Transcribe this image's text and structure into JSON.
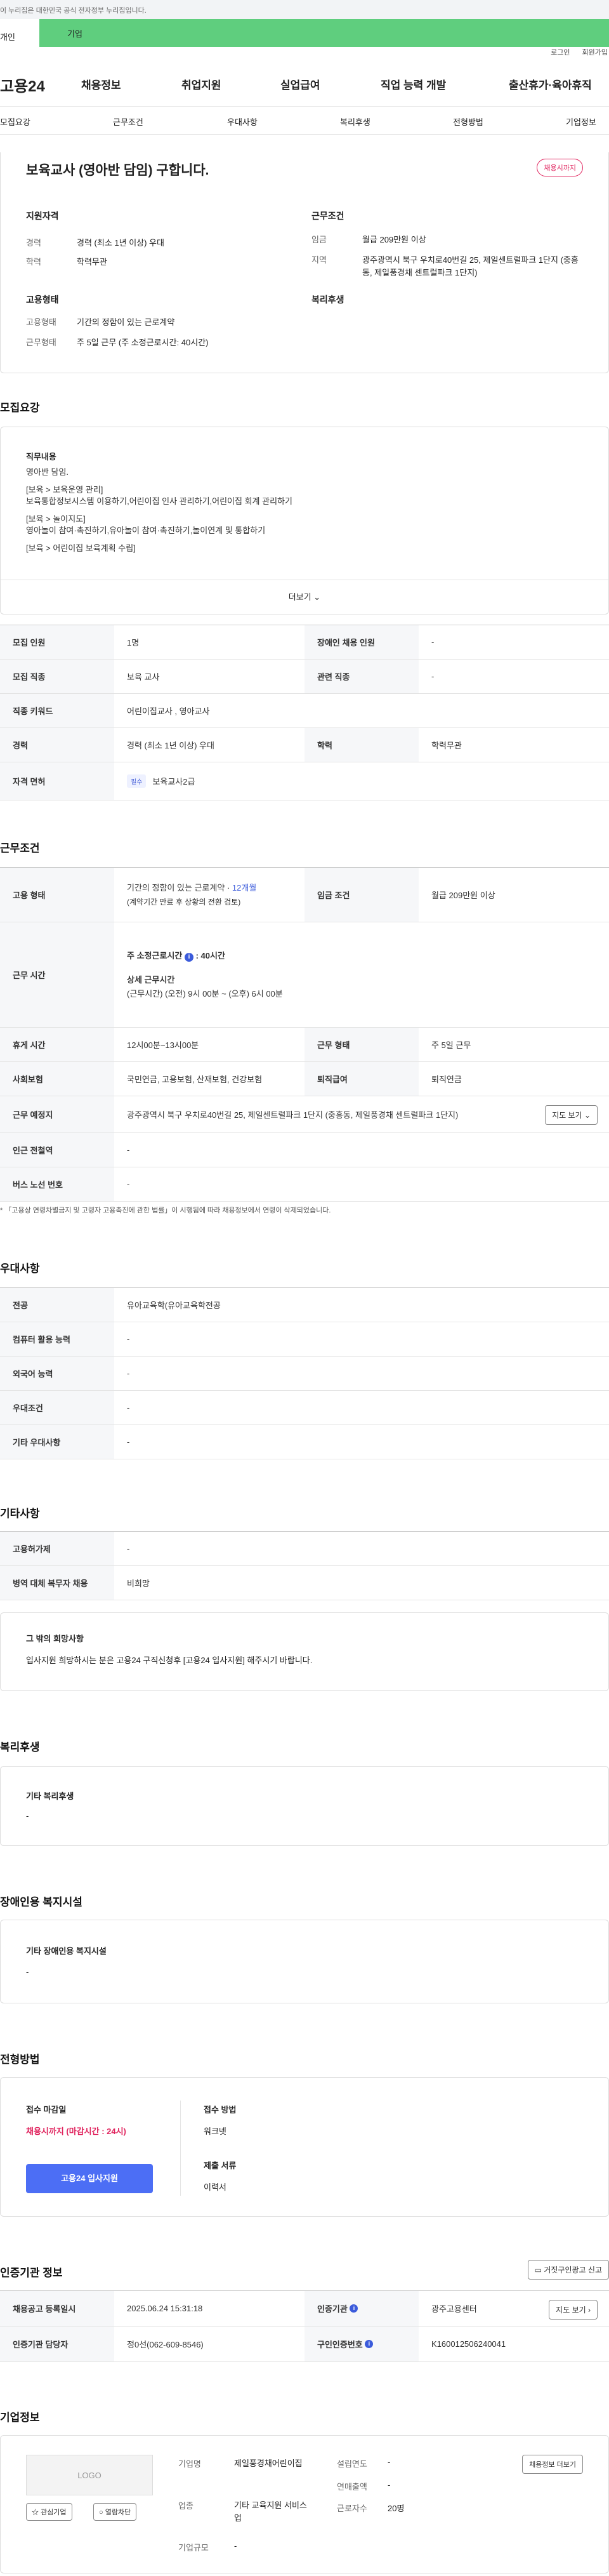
{
  "gov_notice": "이 누리집은 대한민국 공식 전자정부 누리집입니다.",
  "member_tabs": {
    "personal": "개인",
    "business": "기업"
  },
  "util": {
    "login": "로그인",
    "join": "회원가입"
  },
  "logo": "고용24",
  "gnb": [
    "채용정보",
    "취업지원",
    "실업급여",
    "직업 능력 개발",
    "출산휴가·육아휴직"
  ],
  "subnav": [
    "모집요강",
    "근무조건",
    "우대사항",
    "복리후생",
    "전형방법",
    "기업정보"
  ],
  "summary": {
    "title": "보육교사 (영아반 담임) 구합니다.",
    "badge": "채용시까지",
    "qual_title": "지원자격",
    "qual": [
      {
        "k": "경력",
        "v": "경력 (최소 1년 이상) 우대"
      },
      {
        "k": "학력",
        "v": "학력무관"
      }
    ],
    "cond_title": "근무조건",
    "cond": [
      {
        "k": "임금",
        "v": "월급 209만원 이상"
      },
      {
        "k": "지역",
        "v": "광주광역시 북구 우치로40번길 25, 제일센트럴파크 1단지 (중흥동, 제일풍경채 센트럴파크 1단지)"
      }
    ],
    "emp_title": "고용형태",
    "emp": [
      {
        "k": "고용형태",
        "v": "기간의 정함이 있는 근로계약"
      },
      {
        "k": "근무형태",
        "v": "주 5일 근무 (주 소정근로시간: 40시간)"
      }
    ],
    "welfare_title": "복리후생"
  },
  "recruit": {
    "heading": "모집요강",
    "duty_title": "직무내용",
    "duty_lines": [
      "영아반 담임.",
      "",
      "[보육 > 보육운영 관리]",
      "보육통합정보시스템 이용하기,어린이집 인사 관리하기,어린이집 회계 관리하기",
      "",
      "[보육 > 놀이지도]",
      "영아놀이 참여·촉진하기,유아놀이 참여·촉진하기,놀이연계 및 통합하기",
      "",
      "[보육 > 어린이집 보육계획 수립]"
    ],
    "more": "더보기",
    "rows": [
      {
        "k": "모집 인원",
        "v": "1명",
        "k2": "장애인 채용 인원",
        "v2": "-"
      },
      {
        "k": "모집 직종",
        "v": "보육 교사",
        "k2": "관련 직종",
        "v2": "-"
      },
      {
        "k": "직종 키워드",
        "v": "어린이집교사 , 영아교사"
      },
      {
        "k": "경력",
        "v": "경력 (최소 1년 이상) 우대",
        "k2": "학력",
        "v2": "학력무관"
      },
      {
        "k": "자격 면허",
        "badge": "필수",
        "v": "보육교사2급"
      }
    ]
  },
  "work": {
    "heading": "근무조건",
    "emp_k": "고용 형태",
    "emp_v1": "기간의 정함이 있는 근로계약 · ",
    "emp_period": "12개월",
    "emp_v2": "(계약기간 만료 후 상황의 전환 검토)",
    "wage_k": "임금 조건",
    "wage_v": "월급 209만원 이상",
    "hours_k": "근무 시간",
    "hours_week_label": "주 소정근로시간",
    "hours_week_value": ": 40시간",
    "hours_detail_label": "상세 근무시간",
    "hours_detail_value": "(근무시간) (오전) 9시 00분 ~ (오후) 6시 00분",
    "rows": [
      {
        "k": "휴게 시간",
        "v": "12시00분~13시00분",
        "k2": "근무 형태",
        "v2": "주 5일 근무"
      },
      {
        "k": "사회보험",
        "v": "국민연금, 고용보험, 산재보험, 건강보험",
        "k2": "퇴직급여",
        "v2": "퇴직연금"
      },
      {
        "k": "근무 예정지",
        "v": "광주광역시 북구 우치로40번길 25, 제일센트럴파크 1단지 (중흥동, 제일풍경채 센트럴파크 1단지)",
        "btn": "지도 보기"
      },
      {
        "k": "인근 전철역",
        "v": "-"
      },
      {
        "k": "버스 노선 번호",
        "v": "-"
      }
    ],
    "note": "* 「고용상 연령차별금지 및 고령자 고용촉진에 관한 법률」이 시행됨에 따라 채용정보에서 연령이 삭제되었습니다."
  },
  "pref": {
    "heading": "우대사항",
    "rows": [
      {
        "k": "전공",
        "v": "유아교육학(유아교육학전공"
      },
      {
        "k": "컴퓨터 활용 능력",
        "v": "-"
      },
      {
        "k": "외국어 능력",
        "v": "-"
      },
      {
        "k": "우대조건",
        "v": "-"
      },
      {
        "k": "기타 우대사항",
        "v": "-"
      }
    ]
  },
  "etc": {
    "heading": "기타사항",
    "rows": [
      {
        "k": "고용허가제",
        "v": "-"
      },
      {
        "k": "병역 대체 복무자 채용",
        "v": "비희망"
      }
    ],
    "other_title": "그 밖의 희망사항",
    "other_text": "입사지원 희망하시는 분은 고용24 구직신청후 [고용24 입사지원] 해주시기 바랍니다."
  },
  "welfare": {
    "heading": "복리후생",
    "title": "기타 복리후생",
    "value": "-"
  },
  "disabled": {
    "heading": "장애인용 복지시설",
    "title": "기타 장애인용 복지시설",
    "value": "-"
  },
  "selection": {
    "heading": "전형방법",
    "deadline_title": "접수 마감일",
    "deadline_value": "채용시까지 (마감시간 : 24시)",
    "apply_btn": "고용24 입사지원",
    "method_title": "접수 방법",
    "method_value": "워크넷",
    "docs_title": "제출 서류",
    "docs_value": "이력서"
  },
  "auth": {
    "heading": "인증기관 정보",
    "report_btn": "거짓구인광고 신고",
    "rows": [
      {
        "k": "채용공고 등록일시",
        "v": "2025.06.24 15:31:18",
        "k2": "인증기관",
        "v2": "광주고용센터",
        "btn": "지도 보기"
      },
      {
        "k": "인증기관 담당자",
        "v": "정0선(062-609-8546)",
        "k2": "구인인증번호",
        "v2": "K160012506240041"
      }
    ]
  },
  "company": {
    "heading": "기업정보",
    "logo_text": "LOGO",
    "fav_btn": "관심기업",
    "block_btn": "열람차단",
    "name_k": "기업명",
    "name_v": "제일풍경채어린이집",
    "found_k": "설립연도",
    "found_v": "-",
    "biz_k": "업종",
    "biz_v": "기타 교육지원 서비스업",
    "sales_k": "연매출액",
    "sales_v": "-",
    "emp_k": "근로자수",
    "emp_v": "20명",
    "scale_k": "기업규모",
    "scale_v": "-",
    "more_btn": "채용정보 더보기"
  }
}
